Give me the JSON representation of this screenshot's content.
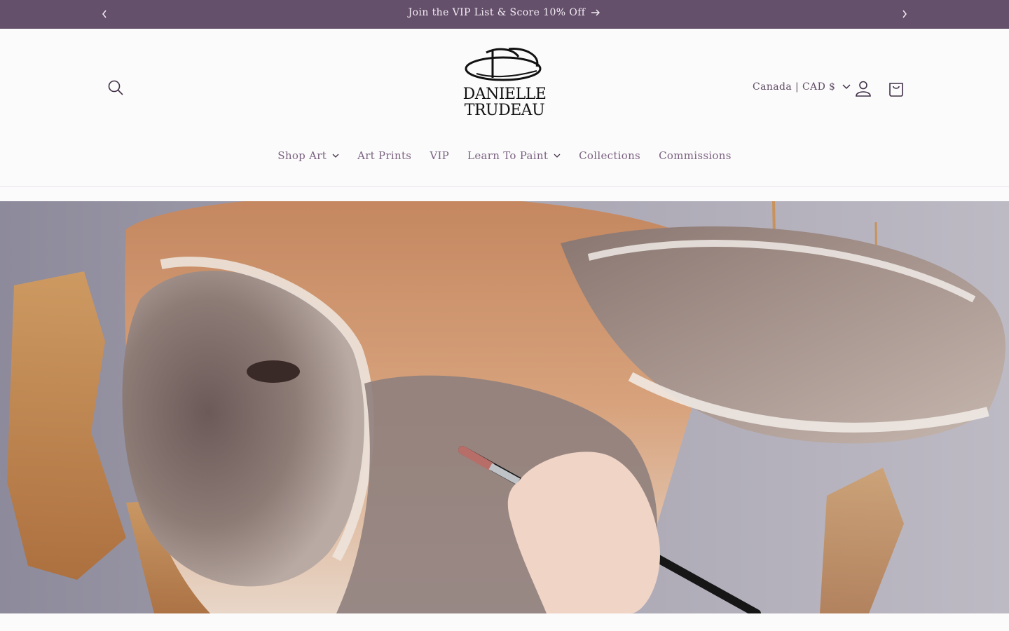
{
  "announcement": {
    "text": "Join the VIP List & Score 10% Off",
    "prev_icon": "chevron-left-icon",
    "next_icon": "chevron-right-icon"
  },
  "header": {
    "logo": {
      "line1": "DANIELLE",
      "line2": "TRUDEAU"
    },
    "country_selector": "Canada | CAD $",
    "icons": [
      "search-icon",
      "account-icon",
      "cart-icon"
    ]
  },
  "nav": {
    "items": [
      {
        "label": "Shop Art",
        "has_dropdown": true
      },
      {
        "label": "Art Prints",
        "has_dropdown": false
      },
      {
        "label": "VIP",
        "has_dropdown": false
      },
      {
        "label": "Learn To Paint",
        "has_dropdown": true
      },
      {
        "label": "Collections",
        "has_dropdown": false
      },
      {
        "label": "Commissions",
        "has_dropdown": false
      }
    ]
  },
  "colors": {
    "announcement_bg": "#65506b",
    "accent_text": "#7a6280",
    "page_bg": "#fcfbfc"
  }
}
